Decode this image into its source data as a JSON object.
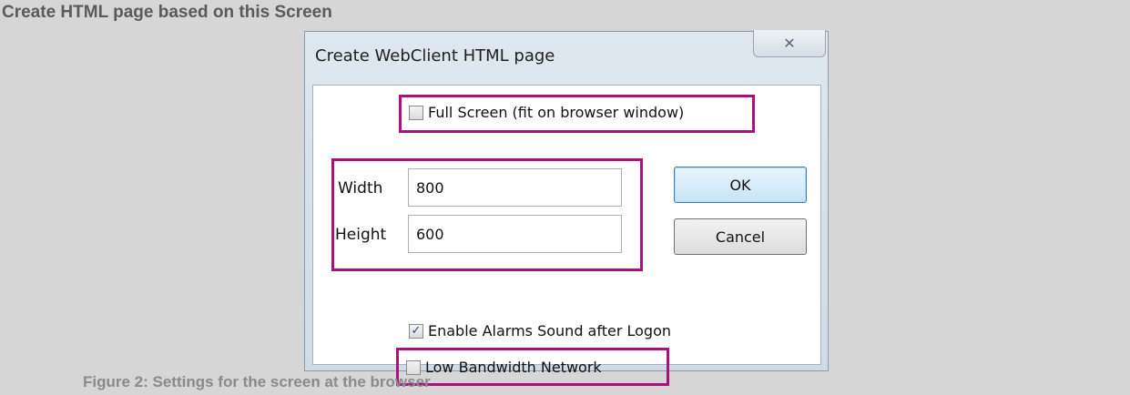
{
  "heading": "Create HTML page based on this Screen",
  "caption": "Figure 2: Settings for the screen at the browser",
  "dialog": {
    "title": "Create WebClient HTML page",
    "close_glyph": "✕",
    "full_screen": {
      "label": "Full Screen (fit on browser window)",
      "checked": false
    },
    "width": {
      "label": "Width",
      "value": "800"
    },
    "height": {
      "label": "Height",
      "value": "600"
    },
    "ok_label": "OK",
    "cancel_label": "Cancel",
    "enable_alarms": {
      "label": "Enable Alarms Sound after Logon",
      "checked": true,
      "mark": "✓"
    },
    "low_bandwidth": {
      "label": "Low Bandwidth Network",
      "checked": false
    }
  },
  "colors": {
    "highlight": "#a8127a",
    "page_bg": "#d6d6d6"
  }
}
